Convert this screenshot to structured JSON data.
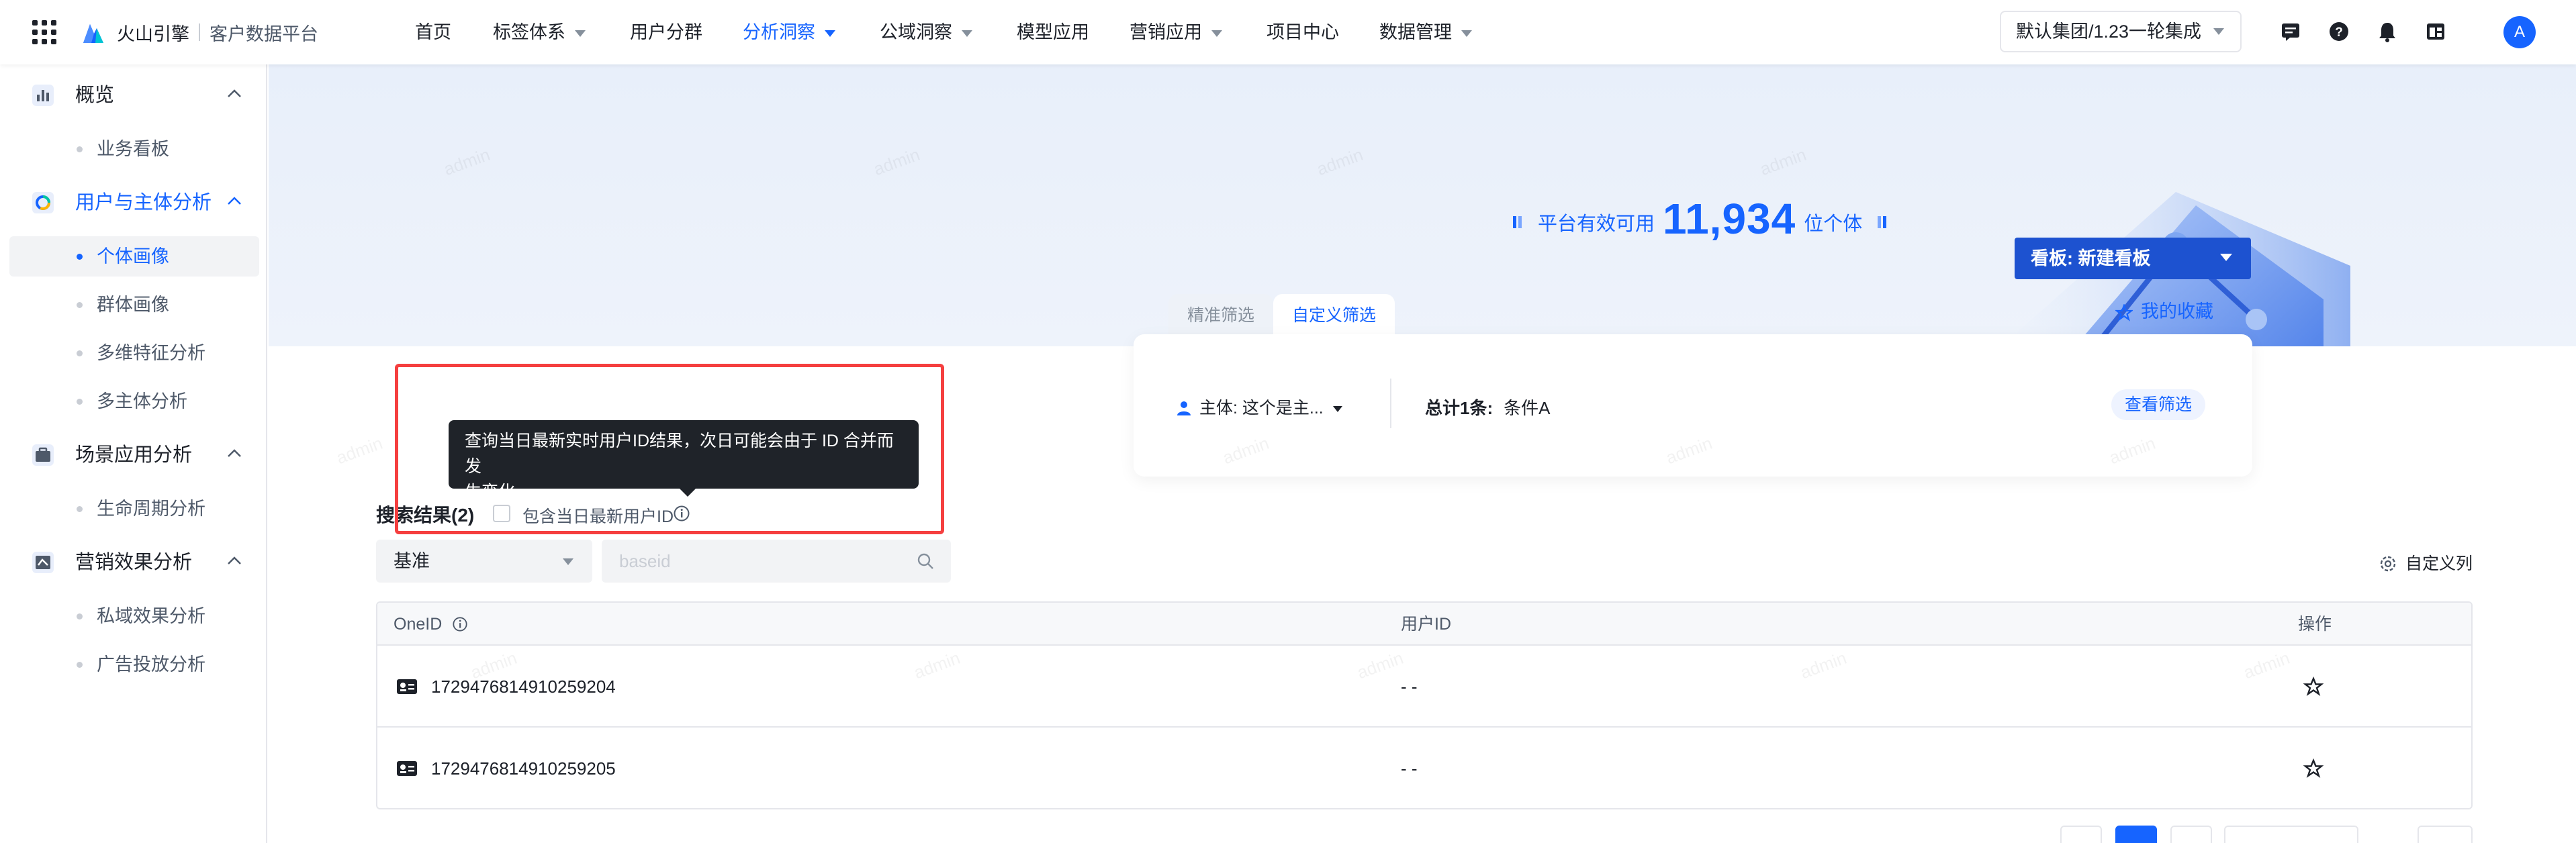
{
  "topnav": {
    "brand": "火山引擎",
    "product": "客户数据平台",
    "items": [
      {
        "label": "首页",
        "dropdown": false,
        "active": false
      },
      {
        "label": "标签体系",
        "dropdown": true,
        "active": false
      },
      {
        "label": "用户分群",
        "dropdown": false,
        "active": false
      },
      {
        "label": "分析洞察",
        "dropdown": true,
        "active": true
      },
      {
        "label": "公域洞察",
        "dropdown": true,
        "active": false
      },
      {
        "label": "模型应用",
        "dropdown": false,
        "active": false
      },
      {
        "label": "营销应用",
        "dropdown": true,
        "active": false
      },
      {
        "label": "项目中心",
        "dropdown": false,
        "active": false
      },
      {
        "label": "数据管理",
        "dropdown": true,
        "active": false
      }
    ],
    "org_select": "默认集团/1.23一轮集成",
    "icons": [
      "message-icon",
      "help-icon",
      "bell-icon",
      "panel-icon"
    ],
    "avatar": "A",
    "accent": "#1664ff"
  },
  "sidebar": {
    "groups": [
      {
        "label": "概览",
        "icon": "bar-chart-icon",
        "active": false,
        "items": [
          {
            "label": "业务看板",
            "active": false
          }
        ]
      },
      {
        "label": "用户与主体分析",
        "icon": "user-analysis-icon",
        "active": true,
        "items": [
          {
            "label": "个体画像",
            "active": true
          },
          {
            "label": "群体画像",
            "active": false
          },
          {
            "label": "多维特征分析",
            "active": false
          },
          {
            "label": "多主体分析",
            "active": false
          }
        ]
      },
      {
        "label": "场景应用分析",
        "icon": "briefcase-icon",
        "active": false,
        "items": [
          {
            "label": "生命周期分析",
            "active": false
          }
        ]
      },
      {
        "label": "营销效果分析",
        "icon": "marketing-icon",
        "active": false,
        "items": [
          {
            "label": "私域效果分析",
            "active": false
          },
          {
            "label": "广告投放分析",
            "active": false
          }
        ]
      }
    ]
  },
  "banner": {
    "stat_prefix": "平台有效可用",
    "stat_value": "11,934",
    "stat_suffix": "位个体",
    "board_button": "看板: 新建看板",
    "favorites": "我的收藏"
  },
  "filter": {
    "tabs": [
      {
        "label": "精准筛选",
        "active": false
      },
      {
        "label": "自定义筛选",
        "active": true
      }
    ],
    "subject": "主体: 这个是主...",
    "total_label": "总计1条:",
    "total_value": "条件A",
    "view_button": "查看筛选"
  },
  "tooltip": {
    "line1": "查询当日最新实时用户ID结果，次日可能会由于 ID 合并而发",
    "line2": "生变化"
  },
  "results": {
    "title": "搜索结果(2)",
    "checkbox_label": "包含当日最新用户ID",
    "checkbox_checked": false,
    "select_value": "基准",
    "search_placeholder": "baseid",
    "custom_columns": "自定义列",
    "columns": [
      "OneID",
      "用户ID",
      "操作"
    ],
    "rows": [
      {
        "oneid": "1729476814910259204",
        "userid": "- -"
      },
      {
        "oneid": "1729476814910259205",
        "userid": "- -"
      }
    ]
  },
  "watermark": "admin"
}
